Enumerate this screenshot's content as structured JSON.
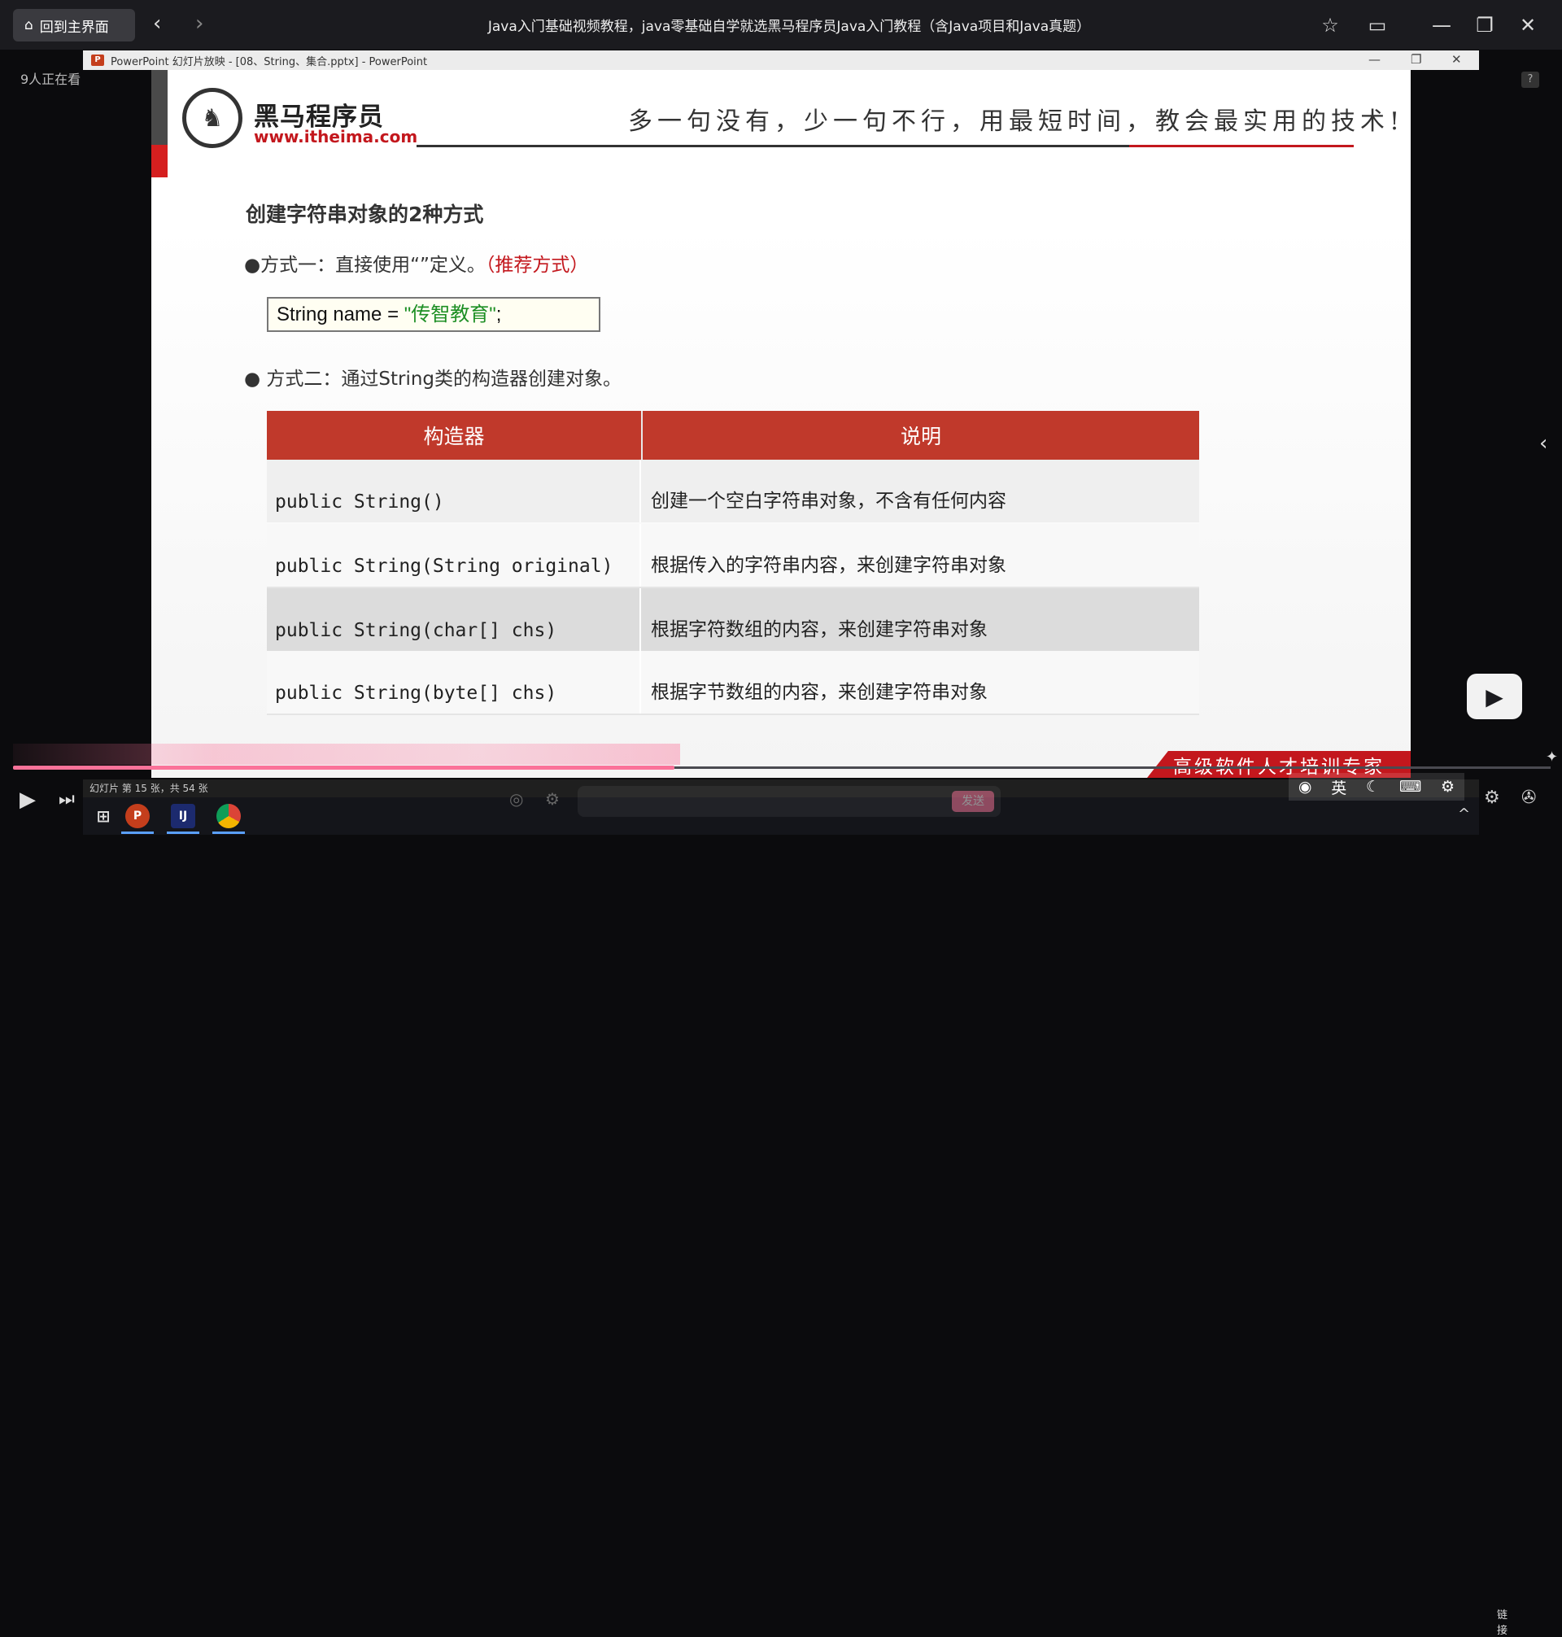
{
  "topbar": {
    "home_label": "回到主界面",
    "title": "Java入门基础视频教程，java零基础自学就选黑马程序员Java入门教程（含Java项目和Java真题）"
  },
  "ppt_window": {
    "title": "PowerPoint 幻灯片放映 - [08、String、集合.pptx] - PowerPoint",
    "status": "幻灯片 第 15 张，共 54 张"
  },
  "viewers": "9人正在看",
  "slide": {
    "logo_name": "黑马程序员",
    "logo_url": "www.itheima.com",
    "slogan": "多一句没有，少一句不行，用最短时间，教会最实用的技术!",
    "title": "创建字符串对象的2种方式",
    "method1_text": "方式一：直接使用“”定义。",
    "method1_note": "（推荐方式）",
    "code_prefix": "String name = ",
    "code_string": "\"传智教育\"",
    "code_suffix": ";",
    "method2_text": "方式二：通过String类的构造器创建对象。",
    "table": {
      "headers": [
        "构造器",
        "说明"
      ],
      "rows": [
        {
          "ctor": "public String()",
          "desc": "创建一个空白字符串对象，不含有任何内容"
        },
        {
          "ctor": "public String(String original)",
          "desc": "根据传入的字符串内容，来创建字符串对象"
        },
        {
          "ctor": "public String(char[] chs)",
          "desc": "根据字符数组的内容，来创建字符串对象"
        },
        {
          "ctor": "public String(byte[] chs)",
          "desc": "根据字节数组的内容，来创建字符串对象"
        }
      ]
    },
    "tagline": "高级软件人才培训专家"
  },
  "player": {
    "send_label": "发送",
    "lang_label": "英",
    "link_label": "链接",
    "progress_fraction": 0.43
  },
  "colors": {
    "brand_red": "#c3171d",
    "table_header": "#c0392b",
    "bilibili_pink": "#fb7299"
  }
}
